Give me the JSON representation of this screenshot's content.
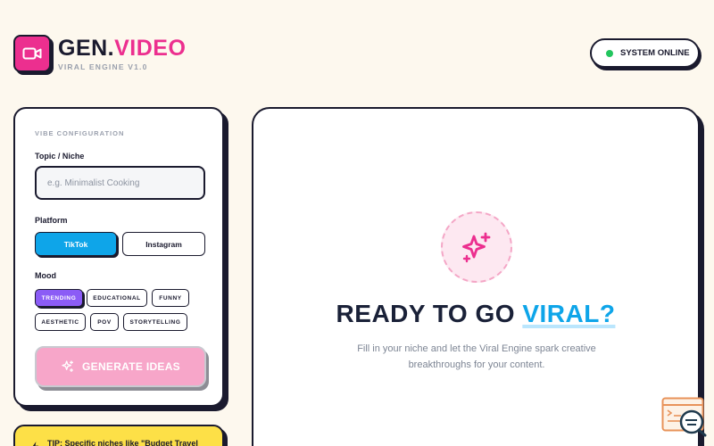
{
  "header": {
    "brand_gen": "GEN.",
    "brand_video": "VIDEO",
    "brand_subtitle": "VIRAL ENGINE V1.0",
    "logo_icon": "video-camera-icon",
    "status_text": "SYSTEM ONLINE",
    "status_color": "#22c55e"
  },
  "config": {
    "section_title": "VIBE CONFIGURATION",
    "topic_label": "Topic / Niche",
    "topic_placeholder": "e.g. Minimalist Cooking",
    "topic_value": "",
    "platform_label": "Platform",
    "platforms": [
      {
        "label": "TikTok",
        "active": true
      },
      {
        "label": "Instagram",
        "active": false
      }
    ],
    "mood_label": "Mood",
    "moods": [
      {
        "label": "TRENDING",
        "active": true
      },
      {
        "label": "EDUCATIONAL",
        "active": false
      },
      {
        "label": "FUNNY",
        "active": false
      },
      {
        "label": "AESTHETIC",
        "active": false
      },
      {
        "label": "POV",
        "active": false
      },
      {
        "label": "STORYTELLING",
        "active": false
      }
    ],
    "generate_label": "GENERATE IDEAS",
    "generate_icon": "sparkles-icon"
  },
  "tip": {
    "text": "TIP: Specific niches like \"Budget Travel"
  },
  "main": {
    "title_prefix": "READY TO GO",
    "title_highlight": "VIRAL?",
    "subtitle": "Fill in your niche and let the Viral Engine spark creative breakthroughs for your content.",
    "hero_icon": "sparkles-icon"
  },
  "colors": {
    "accent_pink": "#ec2f8f",
    "accent_blue": "#0ea5e9",
    "accent_purple": "#8b5cf6",
    "tip_yellow": "#fde047",
    "background": "#fdf8ee"
  }
}
